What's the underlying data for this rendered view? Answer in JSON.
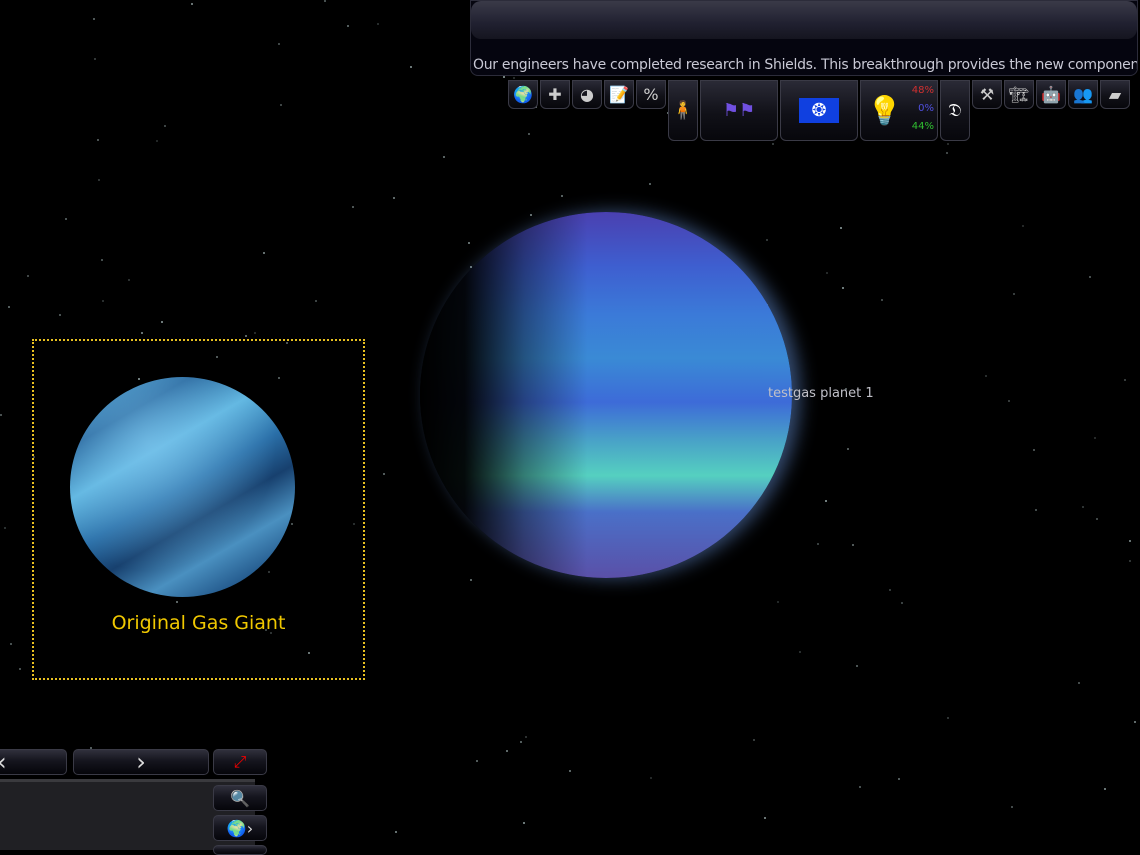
{
  "message_panel": {
    "text": "Our engineers have completed research in Shields. This breakthrough provides  the new component 'Corv"
  },
  "toolbar": {
    "buttons": [
      {
        "icon": "earth-icon",
        "glyph": "🌍"
      },
      {
        "icon": "cross-icon",
        "glyph": "✚"
      },
      {
        "icon": "pie-chart-icon",
        "glyph": "◕"
      },
      {
        "icon": "notepad-icon",
        "glyph": "📝"
      },
      {
        "icon": "percent-icon",
        "glyph": "%"
      }
    ],
    "tabs": [
      {
        "icon": "character-icon",
        "glyph": "🧍"
      },
      {
        "icon": "crossed-flags-icon",
        "glyph": "⚑⚑"
      },
      {
        "icon": "empire-flag-icon",
        "glyph": "❂"
      }
    ],
    "research": {
      "icon": "lightbulb-icon",
      "glyph": "💡",
      "pct1": "48%",
      "pct2": "0%",
      "pct3": "44%",
      "colors": [
        "#d03030",
        "#5050e0",
        "#30c030"
      ]
    },
    "design": {
      "icon": "compass-ruler-icon",
      "glyph": "𝔇"
    },
    "right_buttons": [
      {
        "icon": "hammer-icon",
        "glyph": "⚒"
      },
      {
        "icon": "crane-icon",
        "glyph": "🏗"
      },
      {
        "icon": "soldier-icon",
        "glyph": "🤖"
      },
      {
        "icon": "troops-icon",
        "glyph": "👥"
      },
      {
        "icon": "tank-icon",
        "glyph": "▰"
      }
    ]
  },
  "map": {
    "planet_label": "testgas planet 1"
  },
  "inset": {
    "caption": "Original Gas Giant",
    "border_color": "#e8c020"
  },
  "bottom": {
    "prev": "‹",
    "next": "›",
    "globe_next": "›"
  }
}
